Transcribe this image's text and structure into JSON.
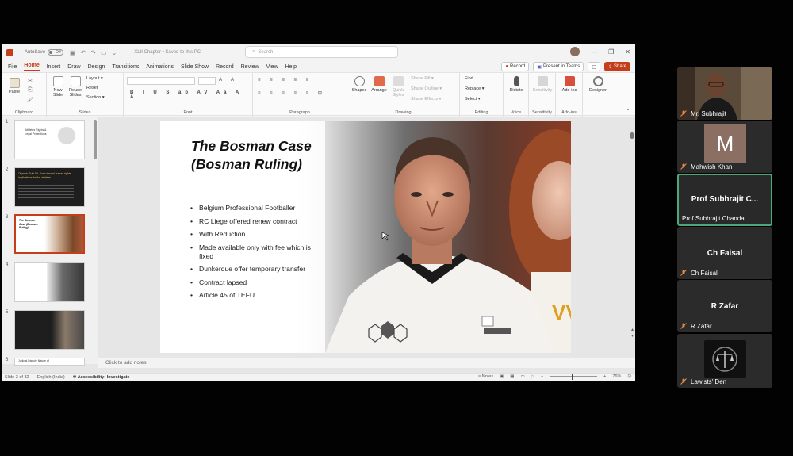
{
  "ppt": {
    "autosave_label": "AutoSave",
    "autosave_state": "Off",
    "doc_title": "XLII Chapter • Saved to this PC",
    "search_placeholder": "Search",
    "menu": [
      "File",
      "Home",
      "Insert",
      "Draw",
      "Design",
      "Transitions",
      "Animations",
      "Slide Show",
      "Record",
      "Review",
      "View",
      "Help"
    ],
    "active_menu": "Home",
    "record_btn": "Record",
    "present_btn": "Present in Teams",
    "share_btn": "Share",
    "ribbon": {
      "paste": "Paste",
      "clipboard": "Clipboard",
      "new_slide": "New Slide",
      "reuse_slides": "Reuse Slides",
      "layout": "Layout",
      "reset": "Reset",
      "section": "Section",
      "slides": "Slides",
      "font": "Font",
      "paragraph": "Paragraph",
      "shapes": "Shapes",
      "arrange": "Arrange",
      "quick_styles": "Quick Styles",
      "shape_fill": "Shape Fill",
      "shape_outline": "Shape Outline",
      "shape_effects": "Shape Effects",
      "drawing": "Drawing",
      "find": "Find",
      "replace": "Replace",
      "select": "Select",
      "editing": "Editing",
      "dictate": "Dictate",
      "voice": "Voice",
      "sensitivity": "Sensitivity",
      "addins": "Add-ins",
      "designer": "Designer"
    },
    "thumbnails": [
      {
        "num": "1",
        "title": "Athletes Rights & Legal Protections"
      },
      {
        "num": "2",
        "title": "Olympic Rule 50: Does toward human rights implications for the athletes"
      },
      {
        "num": "3",
        "title": "The Bosman Case (Bosman Ruling)"
      },
      {
        "num": "4",
        "title": ""
      },
      {
        "num": "5",
        "title": ""
      },
      {
        "num": "6",
        "title": "Judicial Dispute Nature of"
      }
    ],
    "slide": {
      "title": "The Bosman Case (Bosman Ruling)",
      "bullets": [
        "Belgium Professional Footballer",
        "RC Liege offered renew contract",
        "With Reduction",
        "Made available only with fee which is fixed",
        "Dunkerque offer temporary transfer",
        "Contract lapsed",
        "Article 45 of TEFU"
      ]
    },
    "notes_placeholder": "Click to add notes",
    "status": {
      "slide_of": "Slide 3 of 32",
      "language": "English (India)",
      "accessibility": "Accessibility: Investigate",
      "notes": "Notes",
      "zoom": "76%"
    }
  },
  "teams": {
    "participants": [
      {
        "name": "Mr. Subhrajit",
        "type": "video"
      },
      {
        "name": "Mahwish Khan",
        "type": "initial",
        "initial": "M"
      },
      {
        "name": "Prof Subhrajit Chanda",
        "display": "Prof Subhrajit C...",
        "type": "active"
      },
      {
        "name": "Ch Faisal",
        "display": "Ch Faisal",
        "type": "name"
      },
      {
        "name": "R Zafar",
        "display": "R Zafar",
        "type": "name"
      },
      {
        "name": "Lawists' Den",
        "type": "avatar"
      }
    ]
  },
  "colors": {
    "accent": "#c43e1c",
    "active_speaker": "#4ca87b"
  }
}
